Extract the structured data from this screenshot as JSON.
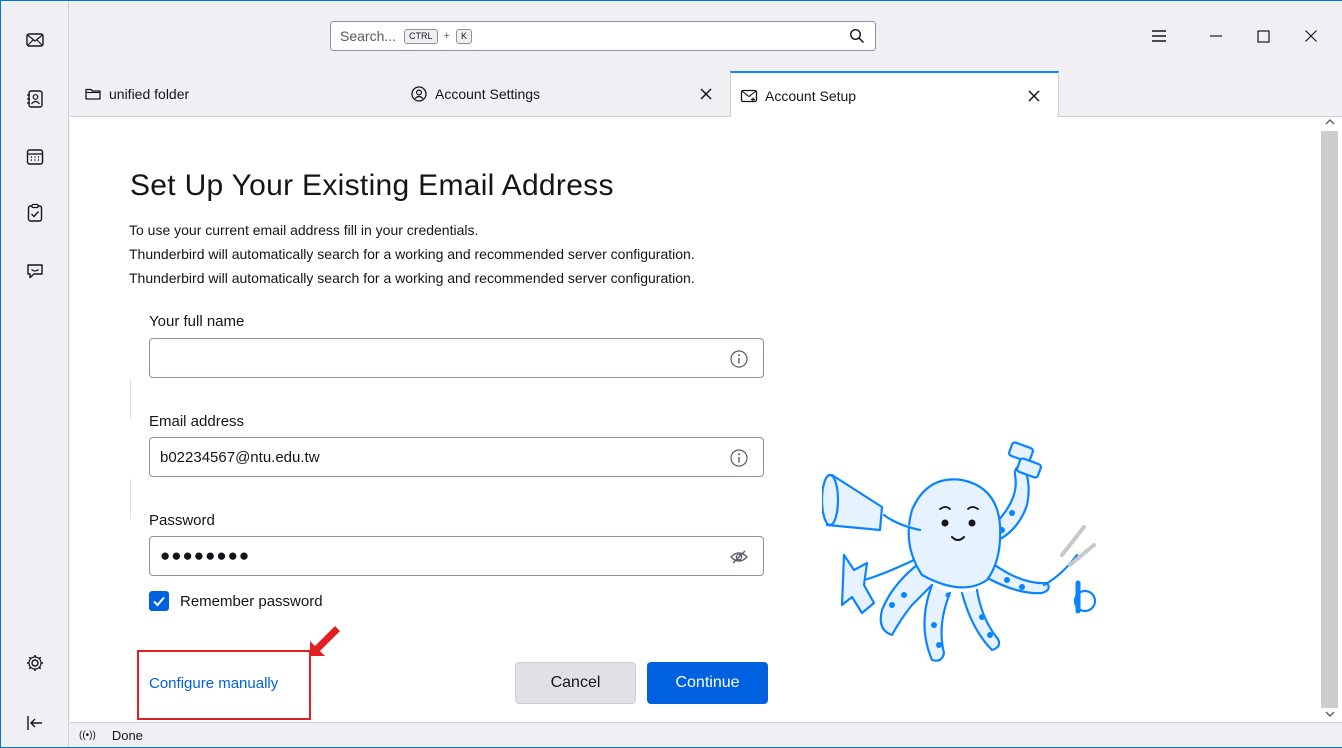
{
  "window": {
    "search_placeholder": "Search...",
    "search_key1": "CTRL",
    "search_plus": "+",
    "search_key2": "K"
  },
  "tabs": [
    {
      "label": "unified folder",
      "icon": "folder-icon"
    },
    {
      "label": "Account Settings",
      "icon": "account-settings-icon"
    },
    {
      "label": "Account Setup",
      "icon": "account-setup-icon",
      "active": true
    }
  ],
  "setup": {
    "title": "Set Up Your Existing Email Address",
    "description_lines": [
      "To use your current email address fill in your credentials.",
      "Thunderbird will automatically search for a working and recommended server configuration.",
      "Thunderbird will automatically search for a working and recommended server configuration."
    ],
    "full_name_label": "Your full name",
    "full_name_value": "",
    "email_label": "Email address",
    "email_value": "b02234567@ntu.edu.tw",
    "password_label": "Password",
    "password_value": "●●●●●●●●",
    "remember_label": "Remember password",
    "remember_checked": true,
    "configure_manually": "Configure manually",
    "cancel_label": "Cancel",
    "continue_label": "Continue"
  },
  "status": {
    "text": "Done"
  },
  "colors": {
    "accent": "#0061e0",
    "highlight": "#e02020",
    "tab_active_border": "#0a84ff"
  }
}
